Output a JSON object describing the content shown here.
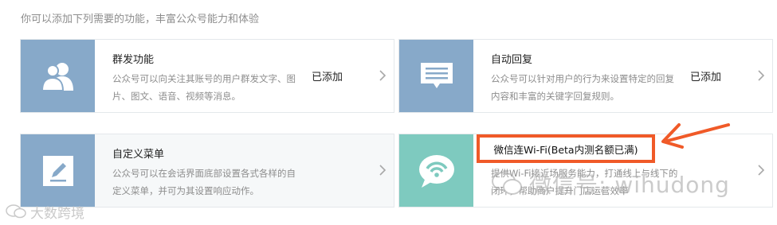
{
  "intro": "你可以添加下列需要的功能，丰富公众号能力和体验",
  "colors": {
    "card_icon_bg": "#87a9c9",
    "wifi_icon_bg": "#7ecabf",
    "callout": "#f05a28"
  },
  "cards": [
    {
      "title": "群发功能",
      "desc": "公众号可以向关注其账号的用户群发文字、图片、图文、语音、视频等消息。",
      "status": "已添加",
      "icon": "users-icon"
    },
    {
      "title": "自动回复",
      "desc": "公众号可以针对用户的行为来设置特定的回复内容和丰富的关键字回复规则。",
      "status": "已添加",
      "icon": "message-icon"
    },
    {
      "title": "自定义菜单",
      "desc": "公众号可以在会话界面底部设置各式各样的自定义菜单，并可为其设置响应动作。",
      "status": "",
      "icon": "pen-icon"
    },
    {
      "title": "微信连Wi-Fi(Beta内测名额已满)",
      "desc": "提供Wi-Fi接近场服务能力，打通线上与线下的闭环，帮助商户提升门店运营效率",
      "status": "",
      "icon": "wifi-icon"
    }
  ],
  "watermarks": {
    "left": "大数跨境",
    "right": "微信号: wihudong"
  }
}
